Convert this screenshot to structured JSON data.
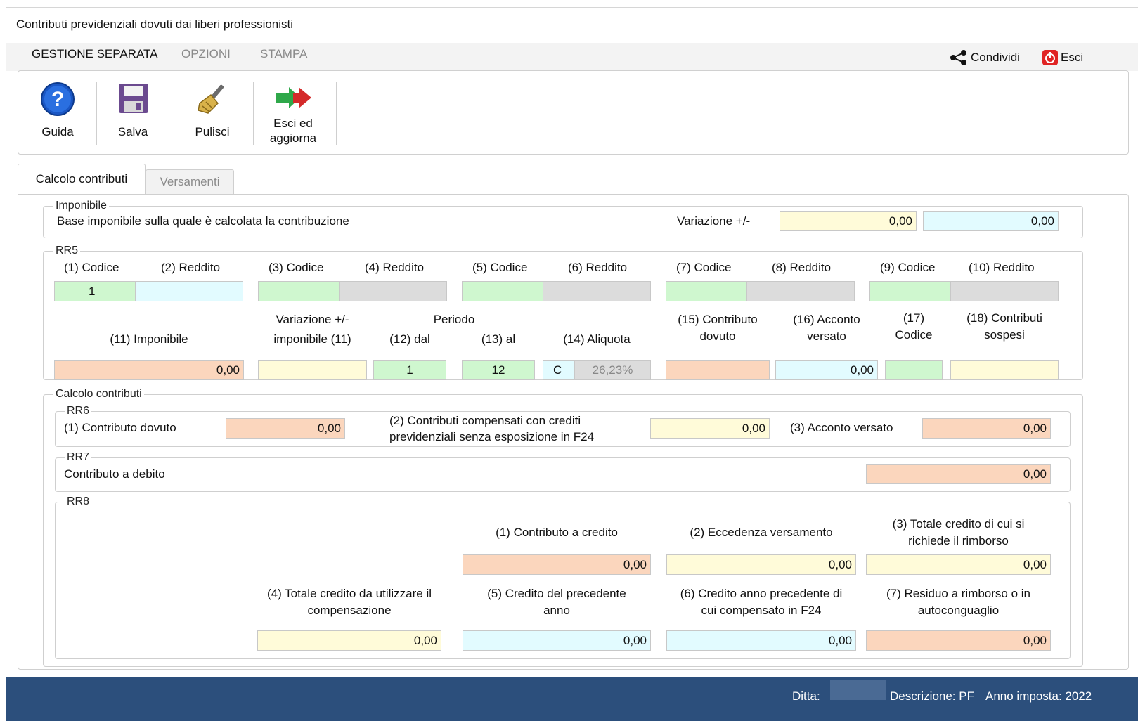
{
  "window": {
    "title": "Contributi previdenziali dovuti dai liberi professionisti"
  },
  "menu": {
    "items": [
      "GESTIONE SEPARATA",
      "OPZIONI",
      "STAMPA"
    ],
    "share": "Condividi",
    "exit": "Esci"
  },
  "toolbar": {
    "help": "Guida",
    "save": "Salva",
    "clean": "Pulisci",
    "exit_update_1": "Esci ed",
    "exit_update_2": "aggiorna"
  },
  "tabs": [
    "Calcolo contributi",
    "Versamenti"
  ],
  "imponibile": {
    "legend": "Imponibile",
    "label": "Base imponibile sulla quale è calcolata la contribuzione",
    "variazione_label": "Variazione +/-",
    "variazione_value": "0,00",
    "total_value": "0,00"
  },
  "rr5": {
    "legend": "RR5",
    "codice_headers": [
      "(1) Codice",
      "(3) Codice",
      "(5) Codice",
      "(7) Codice",
      "(9) Codice"
    ],
    "reddito_headers": [
      "(2) Reddito",
      "(4) Reddito",
      "(6) Reddito",
      "(8) Reddito",
      "(10) Reddito"
    ],
    "codice1_value": "1",
    "imponibile_label": "(11) Imponibile",
    "variazione_label_1": "Variazione +/-",
    "variazione_label_2": "imponibile (11)",
    "periodo_label": "Periodo",
    "dal_label": "(12) dal",
    "al_label": "(13) al",
    "aliquota_label": "(14) Aliquota",
    "contributo_label_1": "(15) Contributo",
    "contributo_label_2": "dovuto",
    "acconto_label_1": "(16) Acconto",
    "acconto_label_2": "versato",
    "codice17_label_1": "(17)",
    "codice17_label_2": "Codice",
    "sospesi_label_1": "(18) Contributi",
    "sospesi_label_2": "sospesi",
    "imponibile_value": "0,00",
    "dal_value": "1",
    "al_value": "12",
    "aliquota_code": "C",
    "aliquota_value": "26,23%",
    "acconto_value": "0,00"
  },
  "calcolo": {
    "legend": "Calcolo contributi",
    "rr6": {
      "legend": "RR6",
      "dovuto_label": "(1) Contributo dovuto",
      "dovuto_value": "0,00",
      "compensati_label_1": "(2) Contributi compensati con crediti",
      "compensati_label_2": "previdenziali senza esposizione in F24",
      "compensati_value": "0,00",
      "acconto_label": "(3) Acconto versato",
      "acconto_value": "0,00"
    },
    "rr7": {
      "legend": "RR7",
      "debito_label": "Contributo a debito",
      "debito_value": "0,00"
    },
    "rr8": {
      "legend": "RR8",
      "credito_label": "(1) Contributo a credito",
      "credito_value": "0,00",
      "eccedenza_label": "(2) Eccedenza versamento",
      "eccedenza_value": "0,00",
      "rimborso_label_1": "(3) Totale credito di cui si",
      "rimborso_label_2": "richiede il rimborso",
      "rimborso_value": "0,00",
      "compensazione_label_1": "(4) Totale credito da utilizzare il",
      "compensazione_label_2": "compensazione",
      "compensazione_value": "0,00",
      "precedente_label_1": "(5) Credito del precedente",
      "precedente_label_2": "anno",
      "precedente_value": "0,00",
      "f24_label_1": "(6) Credito anno precedente di",
      "f24_label_2": "cui compensato in F24",
      "f24_value": "0,00",
      "residuo_label_1": "(7) Residuo a rimborso o in",
      "residuo_label_2": "autoconguaglio",
      "residuo_value": "0,00"
    }
  },
  "status": {
    "ditta": "Ditta:",
    "descrizione": "Descrizione: PF",
    "anno": "Anno imposta: 2022"
  },
  "colors": {
    "status_bar": "#2c4f7c",
    "yellow_field": "#fffbd9",
    "cyan_field": "#e2fbff",
    "green_field": "#cff7cf",
    "orange_field": "#fbd6bd",
    "gray_field": "#dcdcdc"
  }
}
